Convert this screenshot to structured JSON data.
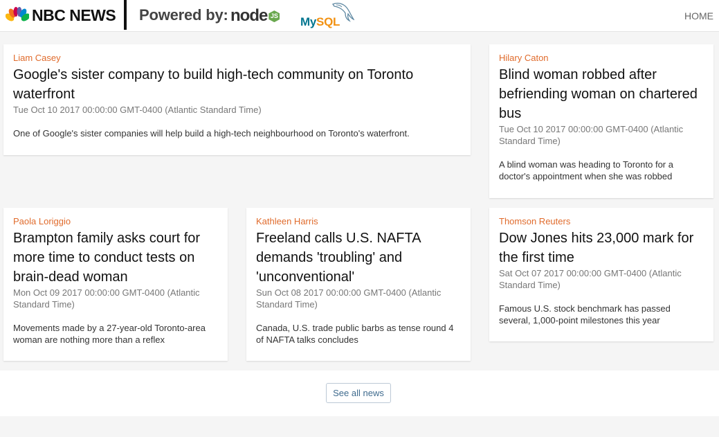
{
  "header": {
    "logo_text": "NBC NEWS",
    "powered_label": "Powered by:",
    "node_logo_text": "node",
    "node_badge": "JS",
    "mysql_my": "My",
    "mysql_sql": "SQL",
    "home_label": "HOME"
  },
  "articles": [
    {
      "author": "Liam Casey",
      "title": "Google's sister company to build high-tech community on Toronto waterfront",
      "date": "Tue Oct 10 2017 00:00:00 GMT-0400 (Atlantic Standard Time)",
      "summary": "One of Google's sister companies will help build a high-tech neighbourhood on Toronto's waterfront."
    },
    {
      "author": "Hilary Caton",
      "title": "Blind woman robbed after befriending woman on chartered bus",
      "date": "Tue Oct 10 2017 00:00:00 GMT-0400 (Atlantic Standard Time)",
      "summary": "A blind woman was heading to Toronto for a doctor's appointment when she was robbed"
    },
    {
      "author": "Paola Loriggio",
      "title": "Brampton family asks court for more time to conduct tests on brain-dead woman",
      "date": "Mon Oct 09 2017 00:00:00 GMT-0400 (Atlantic Standard Time)",
      "summary": "Movements made by a 27-year-old Toronto-area woman are nothing more than a reflex"
    },
    {
      "author": "Kathleen Harris",
      "title": "Freeland calls U.S. NAFTA demands 'troubling' and 'unconventional'",
      "date": "Sun Oct 08 2017 00:00:00 GMT-0400 (Atlantic Standard Time)",
      "summary": "Canada, U.S. trade public barbs as tense round 4 of NAFTA talks concludes"
    },
    {
      "author": "Thomson Reuters",
      "title": "Dow Jones hits 23,000 mark for the first time",
      "date": "Sat Oct 07 2017 00:00:00 GMT-0400 (Atlantic Standard Time)",
      "summary": "Famous U.S. stock benchmark has passed several, 1,000-point milestones this year"
    }
  ],
  "footer": {
    "see_all_label": "See all news"
  },
  "colors": {
    "author": "#e06b2c",
    "button_text": "#3f6b8e",
    "background": "#f5f5f5"
  }
}
